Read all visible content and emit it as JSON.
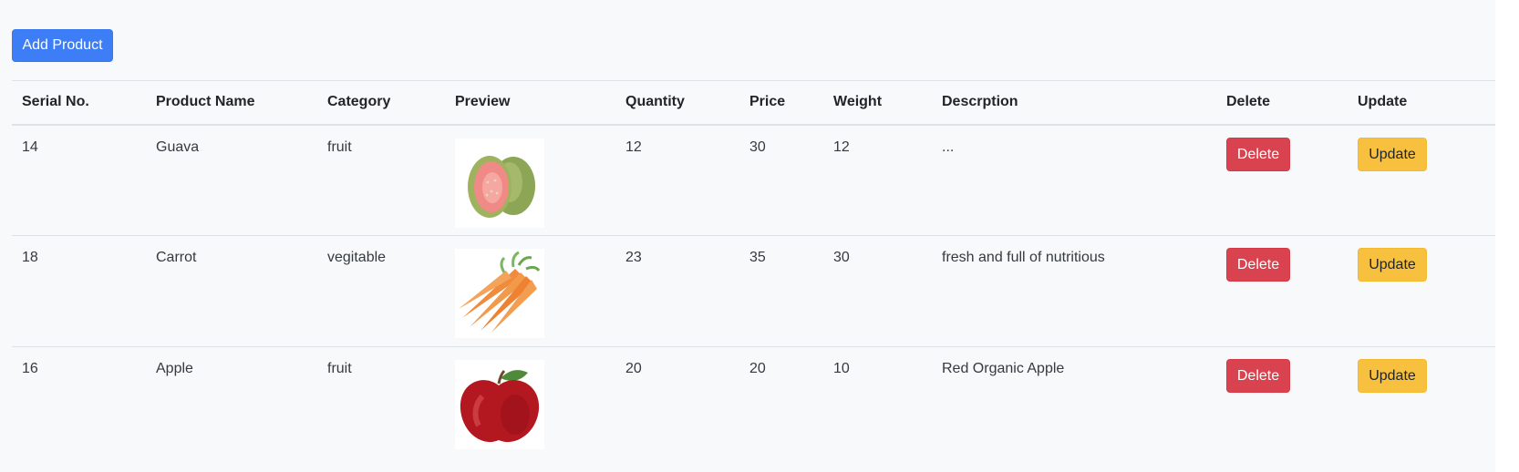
{
  "toolbar": {
    "add_label": "Add Product"
  },
  "table": {
    "headers": [
      "Serial No.",
      "Product Name",
      "Category",
      "Preview",
      "Quantity",
      "Price",
      "Weight",
      "Descrption",
      "Delete",
      "Update"
    ],
    "rows": [
      {
        "serial": "14",
        "name": "Guava",
        "category": "fruit",
        "preview_icon": "guava-image",
        "quantity": "12",
        "price": "30",
        "weight": "12",
        "description": "...",
        "delete_label": "Delete",
        "update_label": "Update"
      },
      {
        "serial": "18",
        "name": "Carrot",
        "category": "vegitable",
        "preview_icon": "carrot-image",
        "quantity": "23",
        "price": "35",
        "weight": "30",
        "description": "fresh and full of nutritious",
        "delete_label": "Delete",
        "update_label": "Update"
      },
      {
        "serial": "16",
        "name": "Apple",
        "category": "fruit",
        "preview_icon": "apple-image",
        "quantity": "20",
        "price": "20",
        "weight": "10",
        "description": "Red Organic Apple",
        "delete_label": "Delete",
        "update_label": "Update"
      }
    ]
  },
  "colors": {
    "primary": "#3d7ef6",
    "danger": "#d9434f",
    "warning": "#f7c13f",
    "background": "#f8f9fa"
  }
}
